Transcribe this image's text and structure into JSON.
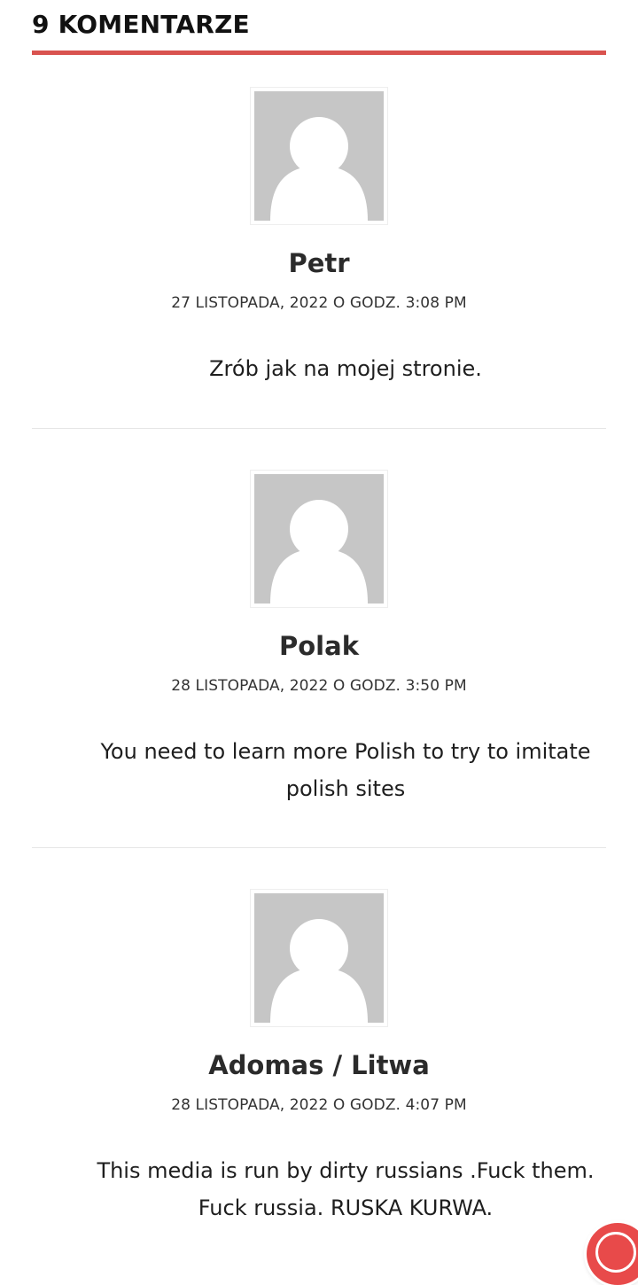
{
  "comments_section": {
    "title": "9 KOMENTARZE",
    "accent_color": "#d9534f"
  },
  "comments": [
    {
      "author": "Petr",
      "date": "27 LISTOPADA, 2022 O GODZ. 3:08 PM",
      "text": "Zrób jak na mojej stronie.",
      "avatar_icon": "default-user-avatar-icon"
    },
    {
      "author": "Polak",
      "date": "28 LISTOPADA, 2022 O GODZ. 3:50 PM",
      "text": "You need to learn more Polish to try to imitate polish sites",
      "avatar_icon": "default-user-avatar-icon"
    },
    {
      "author": "Adomas / Litwa",
      "date": "28 LISTOPADA, 2022 O GODZ. 4:07 PM",
      "text": "This media is run by dirty russians .Fuck them. Fuck russia. RUSKA KURWA.",
      "avatar_icon": "default-user-avatar-icon"
    }
  ],
  "floating_button": {
    "icon": "help-lifebuoy-icon",
    "color": "#e84a4a"
  }
}
